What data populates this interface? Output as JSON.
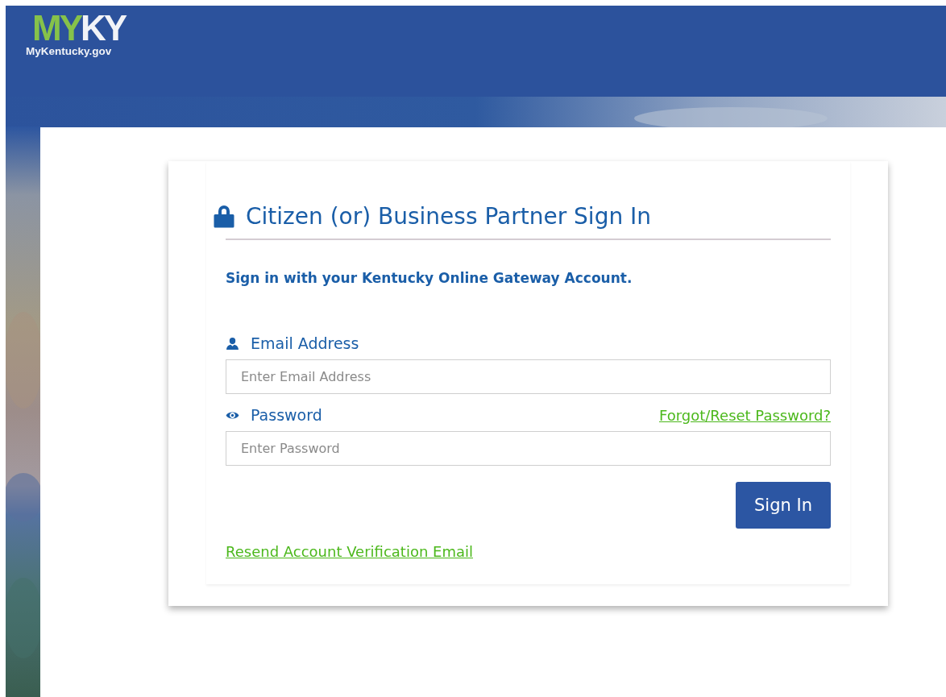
{
  "header": {
    "logo": {
      "mark_green": "MY",
      "mark_white": "KY",
      "domain": "MyKentucky.gov"
    }
  },
  "sign_in": {
    "title": "Citizen (or) Business Partner Sign In",
    "intro": "Sign in with your Kentucky Online Gateway Account.",
    "fields": [
      {
        "kind": "email",
        "label": "Email Address",
        "placeholder": "Enter Email Address"
      },
      {
        "kind": "password",
        "label": "Password",
        "placeholder": "Enter Password",
        "link": "Forgot/Reset Password?"
      }
    ],
    "button": "Sign In",
    "footer_link": "Resend Account Verification Email"
  }
}
